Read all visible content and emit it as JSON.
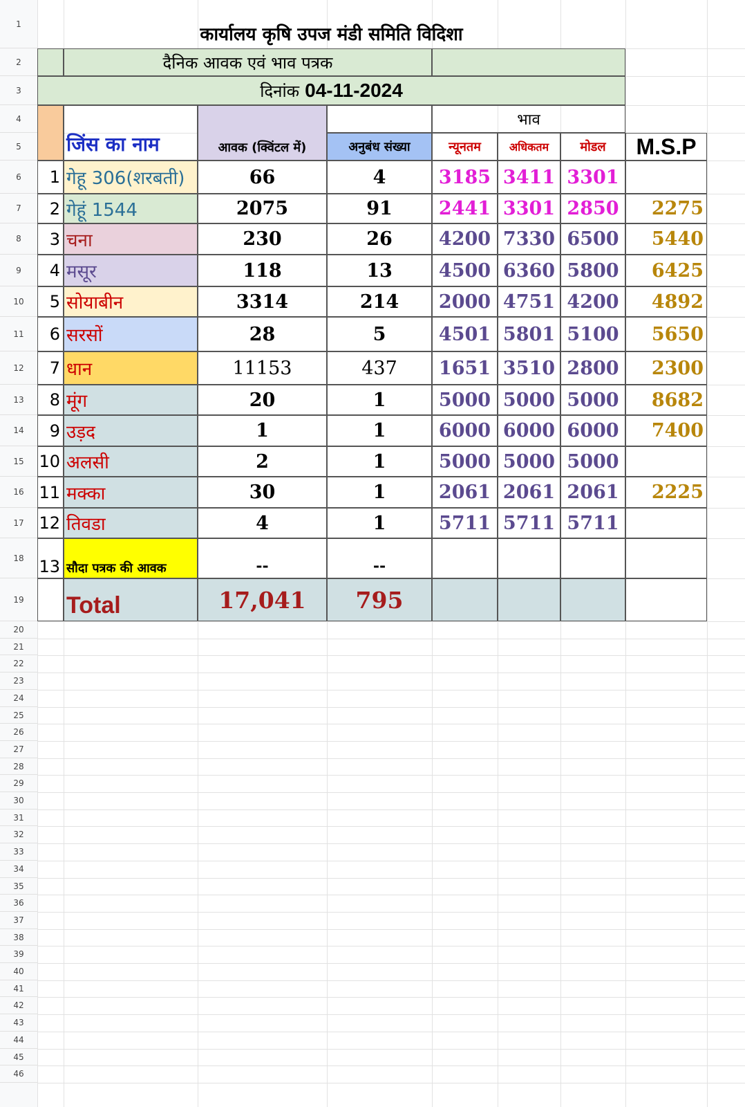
{
  "sheet": {
    "row_numbers": [
      "1",
      "2",
      "3",
      "4",
      "5",
      "6",
      "7",
      "8",
      "9",
      "10",
      "11",
      "12",
      "13",
      "14",
      "15",
      "16",
      "17",
      "18",
      "19",
      "20",
      "21",
      "22",
      "23",
      "24",
      "25",
      "26",
      "27",
      "28",
      "29",
      "30",
      "31",
      "32",
      "33",
      "34",
      "35",
      "36",
      "37",
      "38",
      "39",
      "40",
      "41",
      "42",
      "43",
      "44",
      "45",
      "46"
    ]
  },
  "header": {
    "office_title": "कार्यालय कृषि उपज मंडी समिति विदिशा",
    "subtitle": "दैनिक आवक एवं भाव पत्रक",
    "date_label": "दिनांक",
    "date_value": "04-11-2024"
  },
  "columns": {
    "bhav_group": "भाव",
    "commodity": "जिंस का नाम",
    "arrival": "आवक (क्विंटल में)",
    "contracts": "अनुबंध संख्या",
    "min": "न्यूनतम",
    "max": "अधिकतम",
    "modal": "मोडल",
    "msp": "M.S.P"
  },
  "rows": [
    {
      "sn": "1",
      "name": "गेहू 306(शरबती)",
      "arrival": "66",
      "contracts": "4",
      "min": "3185",
      "max": "3411",
      "modal": "3301",
      "msp": ""
    },
    {
      "sn": "2",
      "name": "गेहूं 1544",
      "arrival": "2075",
      "contracts": "91",
      "min": "2441",
      "max": "3301",
      "modal": "2850",
      "msp": "2275"
    },
    {
      "sn": "3",
      "name": "चना",
      "arrival": "230",
      "contracts": "26",
      "min": "4200",
      "max": "7330",
      "modal": "6500",
      "msp": "5440"
    },
    {
      "sn": "4",
      "name": "मसूर",
      "arrival": "118",
      "contracts": "13",
      "min": "4500",
      "max": "6360",
      "modal": "5800",
      "msp": "6425"
    },
    {
      "sn": "5",
      "name": "सोयाबीन",
      "arrival": "3314",
      "contracts": "214",
      "min": "2000",
      "max": "4751",
      "modal": "4200",
      "msp": "4892"
    },
    {
      "sn": "6",
      "name": "सरसों",
      "arrival": "28",
      "contracts": "5",
      "min": "4501",
      "max": "5801",
      "modal": "5100",
      "msp": "5650"
    },
    {
      "sn": "7",
      "name": "धान",
      "arrival": "11153",
      "contracts": "437",
      "min": "1651",
      "max": "3510",
      "modal": "2800",
      "msp": "2300"
    },
    {
      "sn": "8",
      "name": "मूंग",
      "arrival": "20",
      "contracts": "1",
      "min": "5000",
      "max": "5000",
      "modal": "5000",
      "msp": "8682"
    },
    {
      "sn": "9",
      "name": "उड़द",
      "arrival": "1",
      "contracts": "1",
      "min": "6000",
      "max": "6000",
      "modal": "6000",
      "msp": "7400"
    },
    {
      "sn": "10",
      "name": "अलसी",
      "arrival": "2",
      "contracts": "1",
      "min": "5000",
      "max": "5000",
      "modal": "5000",
      "msp": ""
    },
    {
      "sn": "11",
      "name": "मक्का",
      "arrival": "30",
      "contracts": "1",
      "min": "2061",
      "max": "2061",
      "modal": "2061",
      "msp": "2225"
    },
    {
      "sn": "12",
      "name": "तिवडा",
      "arrival": "4",
      "contracts": "1",
      "min": "5711",
      "max": "5711",
      "modal": "5711",
      "msp": ""
    }
  ],
  "sauda_row": {
    "sn": "13",
    "name": "सौदा पत्रक की आवक",
    "arrival": "--",
    "contracts": "--"
  },
  "total_row": {
    "label": "Total",
    "arrival": "17,041",
    "contracts": "795"
  },
  "colors": {
    "light_green": "#d9ead3",
    "peach": "#f9cb9c",
    "lavender": "#d9d2e9",
    "light_blue": "#a4c2f4",
    "grey_blue": "#d0e0e3",
    "wheat1": "#fff2cc",
    "pink": "#ead1dc",
    "soy": "#fff2cc",
    "mustard_blue": "#c9daf8",
    "paddy": "#ffd966",
    "yellow": "#ffff00",
    "title_blue": "#1c2fc4",
    "red": "#cc0000",
    "magenta": "#e21ed6",
    "purple": "#5b4a8f",
    "gold": "#b8860b",
    "teal_name": "#2a6f97",
    "maroon": "#a61c1c"
  }
}
